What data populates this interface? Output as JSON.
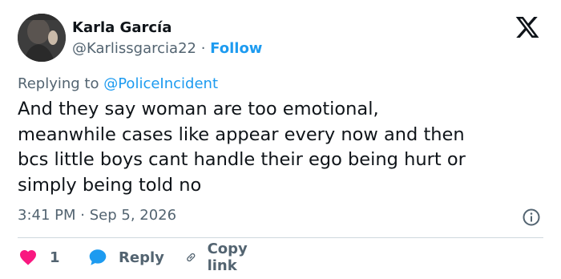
{
  "author": {
    "name": "Karla García",
    "handle": "@Karlissgarcia22",
    "separator": "·",
    "follow_label": "Follow"
  },
  "reply_context": {
    "prefix": "Replying to",
    "mention": "@PoliceIncident"
  },
  "post": {
    "text": "And they say woman are too emotional,\nmeanwhile cases like appear every now and then\nbcs little boys cant handle their ego being hurt or\nsimply being told no"
  },
  "timestamp": {
    "time": "3:41 PM",
    "separator": "·",
    "date": "Sep 5, 2026"
  },
  "actions": {
    "like_count": "1",
    "reply_label": "Reply",
    "copy_link_label": "Copy link"
  },
  "icons": {
    "logo": "x-logo-icon",
    "info": "info-icon",
    "like": "heart-icon",
    "reply": "speech-bubble-icon",
    "copy": "link-icon"
  },
  "colors": {
    "text": "#0f1419",
    "secondary": "#536471",
    "accent": "#1d9bf0",
    "like": "#f91880",
    "divider": "#cfd9de"
  }
}
